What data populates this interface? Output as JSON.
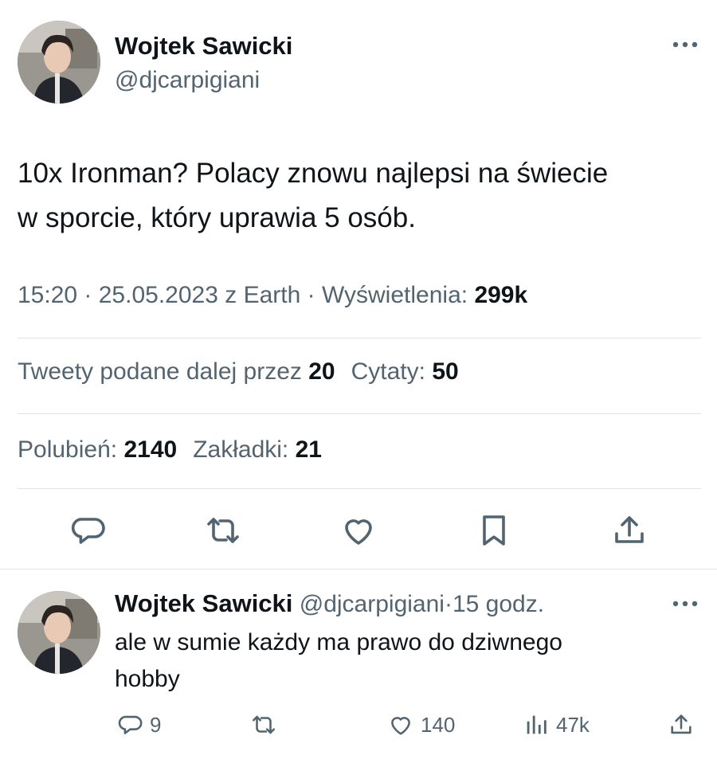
{
  "tweet": {
    "author_name": "Wojtek Sawicki",
    "author_handle": "@djcarpigiani",
    "text_line1": "10x Ironman? Polacy znowu najlepsi na świecie",
    "text_line2": "w sporcie, który uprawia 5 osób.",
    "time": "15:20",
    "date": "25.05.2023",
    "source": "z Earth",
    "views_label": "Wyświetlenia:",
    "views_value": "299k",
    "retweets_label": "Tweety podane dalej przez",
    "retweets_value": "20",
    "quotes_label": "Cytaty:",
    "quotes_value": "50",
    "likes_label": "Polubień:",
    "likes_value": "2140",
    "bookmarks_label": "Zakładki:",
    "bookmarks_value": "21",
    "actions": [
      "reply-icon",
      "retweet-icon",
      "like-icon",
      "bookmark-icon",
      "share-icon"
    ]
  },
  "reply": {
    "author_name": "Wojtek Sawicki",
    "author_handle": "@djcarpigiani",
    "separator": "·",
    "time_ago": "15 godz.",
    "text_line1": "ale w sumie każdy ma prawo do dziwnego",
    "text_line2": "hobby",
    "reply_count": "9",
    "like_count": "140",
    "views_count": "47k"
  },
  "colors": {
    "text_primary": "#0f1419",
    "text_secondary": "#536471",
    "divider": "#dfe3e6"
  }
}
